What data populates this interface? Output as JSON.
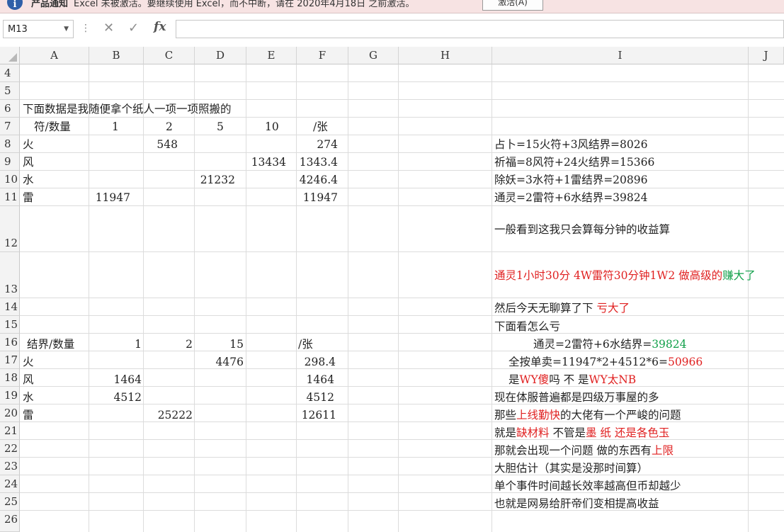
{
  "notice": {
    "title": "产品通知",
    "message": "Excel 未被激活。要继续使用 Excel，而不中断，请在 2020年4月18日 之前激活。",
    "button": "激活(A)"
  },
  "formula_bar": {
    "name_box": "M13",
    "cancel_icon": "✕",
    "enter_icon": "✓",
    "fx_label": "fx",
    "formula": ""
  },
  "columns": [
    "A",
    "B",
    "C",
    "D",
    "E",
    "F",
    "G",
    "H",
    "I",
    "J"
  ],
  "rows": [
    "4",
    "5",
    "6",
    "7",
    "8",
    "9",
    "10",
    "11",
    "12",
    "13",
    "14",
    "15",
    "16",
    "17",
    "18",
    "19",
    "20",
    "21",
    "22",
    "23",
    "24",
    "25",
    "26"
  ],
  "sheet": {
    "r6": {
      "A": "下面数据是我随便拿个纸人一项一项照搬的"
    },
    "r7": {
      "A": "符/数量",
      "B": "1",
      "C": "2",
      "D": "5",
      "E": "10",
      "F": "/张"
    },
    "r8": {
      "A": "火",
      "C": "548",
      "F": "274",
      "I": "占卜=15火符+3风结界=8026"
    },
    "r9": {
      "A": "风",
      "E": "13434",
      "F": "1343.4",
      "I": "祈福=8风符+24火结界=15366"
    },
    "r10": {
      "A": "水",
      "D": "21232",
      "F": "4246.4",
      "I": "除妖=3水符+1雷结界=20896"
    },
    "r11": {
      "A": "雷",
      "B": "11947",
      "F": "11947",
      "I": "通灵=2雷符+6水结界=39824"
    },
    "r12": {
      "I": "一般看到这我只会算每分钟的收益算"
    },
    "r13": {
      "I_red": "通灵1小时30分 4W雷符30分钟1W2  做高级的",
      "I_green": "赚大了"
    },
    "r14": {
      "I": "然后今天无聊算了下 ",
      "I_red": "亏大了"
    },
    "r15": {
      "I": "下面看怎么亏"
    },
    "r16": {
      "A": "结界/数量",
      "B": "1",
      "C": "2",
      "D": "15",
      "F": "/张",
      "I": "通灵=2雷符+6水结界=",
      "I_green": "39824"
    },
    "r17": {
      "A": "火",
      "D": "4476",
      "F": "298.4",
      "I": "全按单卖=11947*2+4512*6=",
      "I_red": "50966"
    },
    "r18": {
      "A": "风",
      "B": "1464",
      "F": "1464",
      "I1": "是",
      "I_red1": "WY傻",
      "I2": "吗 不  是",
      "I_red2": "WY太NB"
    },
    "r19": {
      "A": "水",
      "B": "4512",
      "F": "4512",
      "I": "现在体服普遍都是四级万事屋的多"
    },
    "r20": {
      "A": "雷",
      "C": "25222",
      "F": "12611",
      "I1": "那些",
      "I_red": "上线勤快",
      "I2": "的大佬有一个严峻的问题"
    },
    "r21": {
      "I1": "就是",
      "I_red1": "缺材料",
      "I2": "  不管是",
      "I_red2": "墨 纸 还是各色玉"
    },
    "r22": {
      "I": "那就会出现一个问题  做的东西有",
      "I_red": "上限"
    },
    "r23": {
      "I": "大胆估计（其实是没那时间算）"
    },
    "r24": {
      "I": "单个事件时间越长效率越高但币却越少"
    },
    "r25": {
      "I": "也就是网易给肝帝们变相提高收益"
    }
  },
  "colors": {
    "red": "#e02020",
    "green": "#12a04a",
    "notice_bg": "#f7e3e3",
    "header_bg": "#f3f3f3"
  }
}
